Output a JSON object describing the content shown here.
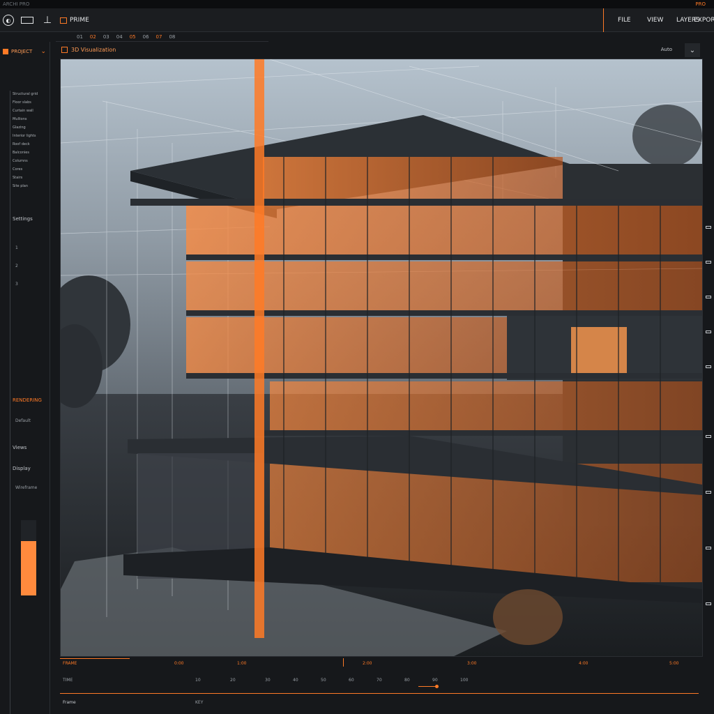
{
  "app": {
    "window_title": "ARCHI PRO",
    "right_status": "PRO",
    "project_label": "PRIME"
  },
  "toolbar": {
    "right_items": [
      "FILE",
      "VIEW",
      "LAYERS",
      "EXPORT"
    ]
  },
  "tabs": [
    "01",
    "02",
    "03",
    "04",
    "05",
    "06",
    "07",
    "08"
  ],
  "sidebar": {
    "header": "PROJECT",
    "list": [
      "Structural grid",
      "Floor slabs",
      "Curtain wall",
      "Mullions",
      "Glazing",
      "Interior lights",
      "Roof deck",
      "Balconies",
      "Columns",
      "Cores",
      "Stairs",
      "Site plan"
    ],
    "section_settings": "Settings",
    "section_render": "RENDERING",
    "section_render_sub": "Default",
    "section_views": "Views",
    "section_display": "Display",
    "display_sub": "Wireframe",
    "level_fraction": 0.72,
    "ticks": [
      "1",
      "2",
      "3"
    ]
  },
  "panel": {
    "title": "3D Visualization",
    "view_label": "Auto"
  },
  "timeline": {
    "labels": [
      "0:00",
      "1:00",
      "2:00",
      "3:00",
      "4:00",
      "5:00"
    ],
    "left_top": "FRAME",
    "left_mid": "TIME",
    "left_bot": "KEY",
    "bottom_left": "Frame",
    "bottom_items": [
      "10",
      "20",
      "30",
      "40",
      "50",
      "60",
      "70",
      "80",
      "90",
      "100"
    ],
    "playhead_fraction": 0.45
  },
  "colors": {
    "accent": "#ff7a26",
    "panel": "#16181b",
    "sky": "#aeb9c4"
  }
}
